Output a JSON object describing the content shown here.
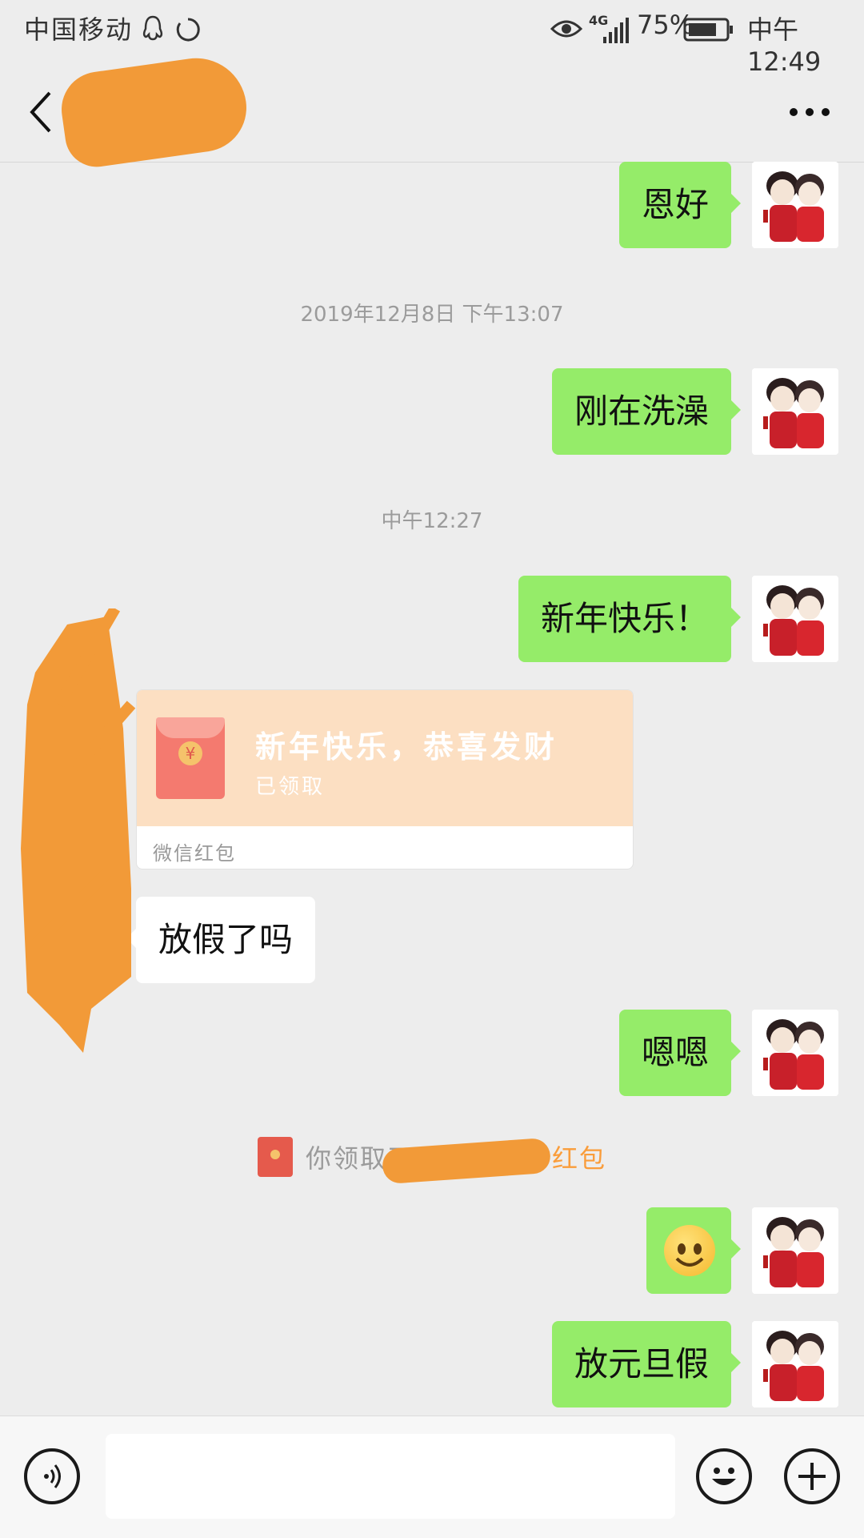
{
  "status_bar": {
    "carrier": "中国移动",
    "network": "4G",
    "battery": "75%",
    "time": "中午12:49"
  },
  "header": {
    "contact_name": ""
  },
  "messages": {
    "m1": "恩好",
    "ts1": "2019年12月8日 下午13:07",
    "m2": "刚在洗澡",
    "ts2": "中午12:27",
    "m3": "新年快乐！",
    "packet": {
      "title": "新年快乐，恭喜发财",
      "status": "已领取",
      "footer": "微信红包"
    },
    "m4": "放假了吗",
    "m5": "嗯嗯",
    "notice_prefix": "你领取了",
    "notice_suffix": "的",
    "notice_link": "红包",
    "m6_emoji": "smiley",
    "m7": "放元旦假"
  },
  "colors": {
    "bubble_me": "#95ec69",
    "bubble_other": "#ffffff",
    "packet_bg": "#fcdfc2",
    "link": "#fa9d3b",
    "redaction": "#f29a38"
  }
}
